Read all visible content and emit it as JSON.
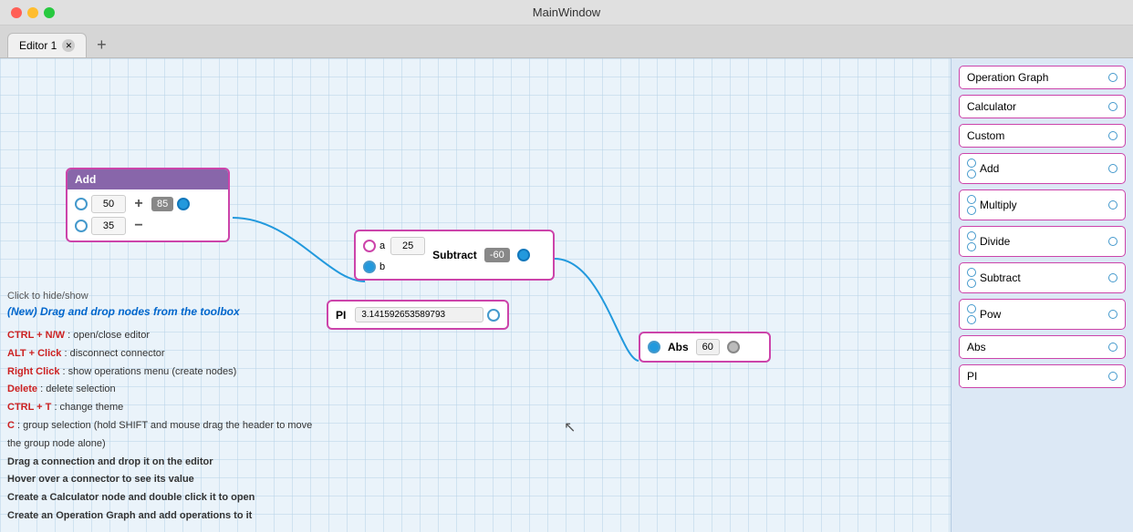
{
  "window": {
    "title": "MainWindow",
    "traffic_lights": [
      "close",
      "minimize",
      "maximize"
    ]
  },
  "tabs": [
    {
      "label": "Editor 1",
      "active": true
    }
  ],
  "tab_add_label": "+",
  "nodes": {
    "add": {
      "header": "Add",
      "input1": "50",
      "input2": "35",
      "output": "85",
      "op1": "+",
      "op2": "−"
    },
    "subtract": {
      "label_a": "a",
      "label_b": "b",
      "input_a": "25",
      "header": "Subtract",
      "output": "-60"
    },
    "pi": {
      "label": "PI",
      "value": "3.141592653589793"
    },
    "abs": {
      "header": "Abs",
      "value": "60"
    }
  },
  "info": {
    "hide_show": "Click to hide/show",
    "new_feature": "(New) Drag and drop nodes from the toolbox",
    "shortcuts": [
      {
        "key": "CTRL + N/W",
        "desc": " : open/close editor"
      },
      {
        "key": "ALT + Click",
        "desc": " : disconnect connector"
      },
      {
        "key": "Right Click",
        "desc": " : show operations menu (create nodes)"
      },
      {
        "key": "Delete",
        "desc": " : delete selection"
      },
      {
        "key": "CTRL + T",
        "desc": " : change theme"
      },
      {
        "key": "C",
        "desc": " : group selection (hold SHIFT and mouse drag the header to move the group node alone)"
      }
    ],
    "tips": [
      "Drag a connection and drop it on the editor",
      "Hover over a connector to see its value",
      "Create a Calculator node and double click it to open",
      "Create an Operation Graph and add operations to it"
    ]
  },
  "toolbox": {
    "items": [
      {
        "label": "Operation Graph",
        "has_right": true
      },
      {
        "label": "Calculator",
        "has_right": true
      },
      {
        "label": "Custom",
        "has_right": true
      },
      {
        "label": "Add",
        "has_pair": true,
        "has_right": true
      },
      {
        "label": "Multiply",
        "has_pair": true,
        "has_right": true
      },
      {
        "label": "Divide",
        "has_pair": true,
        "has_right": true
      },
      {
        "label": "Subtract",
        "has_pair": true,
        "has_right": true
      },
      {
        "label": "Pow",
        "has_pair": true,
        "has_right": true
      },
      {
        "label": "Abs",
        "has_pair": false,
        "has_right": true
      },
      {
        "label": "PI",
        "has_pair": false,
        "has_right": true
      }
    ]
  },
  "colors": {
    "accent_pink": "#cc44aa",
    "accent_blue": "#2299dd",
    "node_header": "#8866aa",
    "canvas_bg": "#eaf3fa",
    "toolbox_bg": "#dce8f5"
  }
}
